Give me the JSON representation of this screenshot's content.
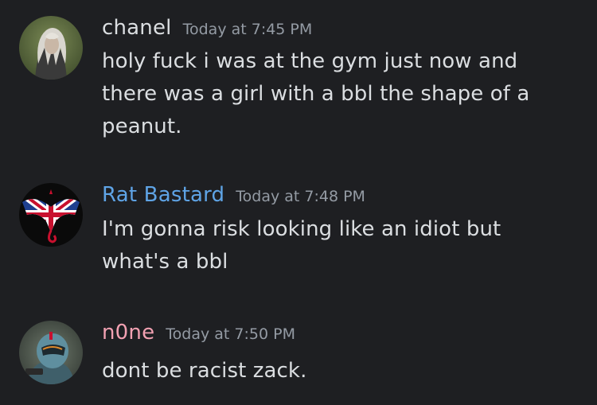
{
  "messages": [
    {
      "author": "chanel",
      "author_color": "#dbdee1",
      "timestamp": "Today at 7:45 PM",
      "avatar_icon": "white-haired-character-avatar",
      "lines": [
        "holy fuck i was at the gym just now and",
        "there was a girl with a bbl the shape of a",
        "peanut."
      ]
    },
    {
      "author": "Rat Bastard",
      "author_color": "#5fa4e6",
      "timestamp": "Today at 7:48 PM",
      "avatar_icon": "union-jack-dragon-avatar",
      "lines": [
        "I'm gonna risk looking like an idiot but",
        "what's a bbl"
      ]
    },
    {
      "author": "n0ne",
      "author_color": "#f2a1b2",
      "timestamp": "Today at 7:50 PM",
      "avatar_icon": "helmeted-soldier-avatar",
      "lines": [
        "dont be racist zack."
      ]
    }
  ]
}
